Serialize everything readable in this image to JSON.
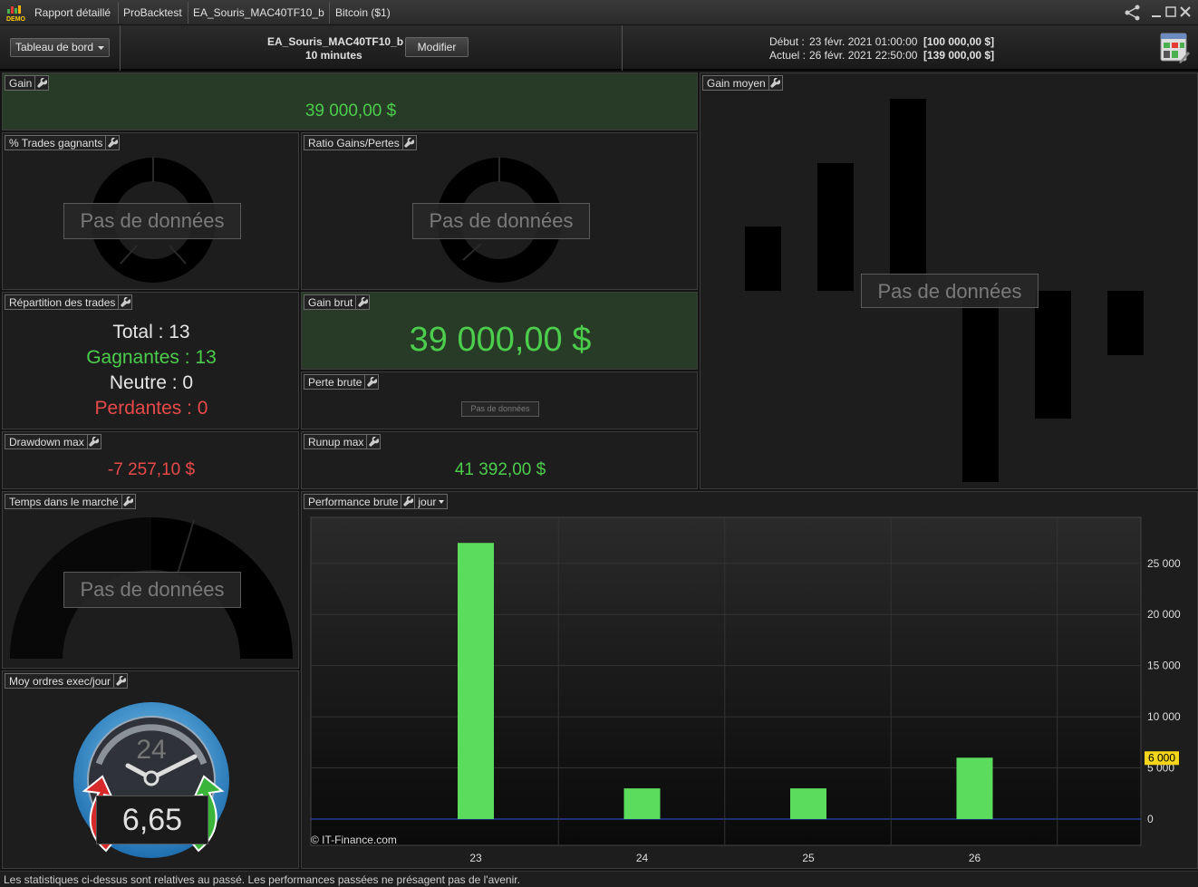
{
  "titlebar": {
    "demo_label": "DEMO",
    "tabs": [
      "Rapport détaillé",
      "ProBacktest",
      "EA_Souris_MAC40TF10_b",
      "Bitcoin ($1)"
    ]
  },
  "header": {
    "dashboard_select": "Tableau de bord",
    "strategy_name": "EA_Souris_MAC40TF10_b",
    "timeframe": "10 minutes",
    "modify_button": "Modifier",
    "start_label": "Début :",
    "start_date": "23 févr. 2021 01:00:00",
    "start_capital": "[100 000,00 $]",
    "current_label": "Actuel :",
    "current_date": "26 févr. 2021 22:50:00",
    "current_capital": "[139 000,00 $]"
  },
  "panels": {
    "gain": {
      "title": "Gain",
      "value": "39 000,00 $"
    },
    "win_pct": {
      "title": "% Trades gagnants",
      "no_data": "Pas de données"
    },
    "ratio": {
      "title": "Ratio Gains/Pertes",
      "no_data": "Pas de données"
    },
    "avg_gain": {
      "title": "Gain moyen",
      "no_data": "Pas de données"
    },
    "distribution": {
      "title": "Répartition des trades",
      "total": "Total : 13",
      "winners": "Gagnantes : 13",
      "neutral": "Neutre : 0",
      "losers": "Perdantes : 0"
    },
    "gross_gain": {
      "title": "Gain brut",
      "value": "39 000,00 $"
    },
    "gross_loss": {
      "title": "Perte brute",
      "no_data": "Pas de données"
    },
    "drawdown": {
      "title": "Drawdown max",
      "value": "-7 257,10 $"
    },
    "runup": {
      "title": "Runup max",
      "value": "41 392,00 $"
    },
    "time_in_market": {
      "title": "Temps dans le marché",
      "no_data": "Pas de données"
    },
    "orders_per_day": {
      "title": "Moy ordres exec/jour",
      "clock_number": "24",
      "value": "6,65"
    },
    "performance": {
      "title": "Performance brute",
      "period_select": "jour",
      "copyright": "© IT-Finance.com"
    }
  },
  "chart_data": {
    "type": "bar",
    "categories": [
      "23",
      "24",
      "25",
      "26"
    ],
    "values": [
      27000,
      3000,
      3000,
      6000
    ],
    "y_ticks": [
      "0",
      "5 000",
      "10 000",
      "15 000",
      "20 000",
      "25 000"
    ],
    "ylim": [
      0,
      29500
    ],
    "last_value_label": "6 000",
    "bar_color": "#5cdc5c",
    "zero_line_color": "#3050d0"
  },
  "footer": {
    "disclaimer": "Les statistiques ci-dessus sont relatives au passé. Les performances passées ne présagent pas de l'avenir."
  }
}
